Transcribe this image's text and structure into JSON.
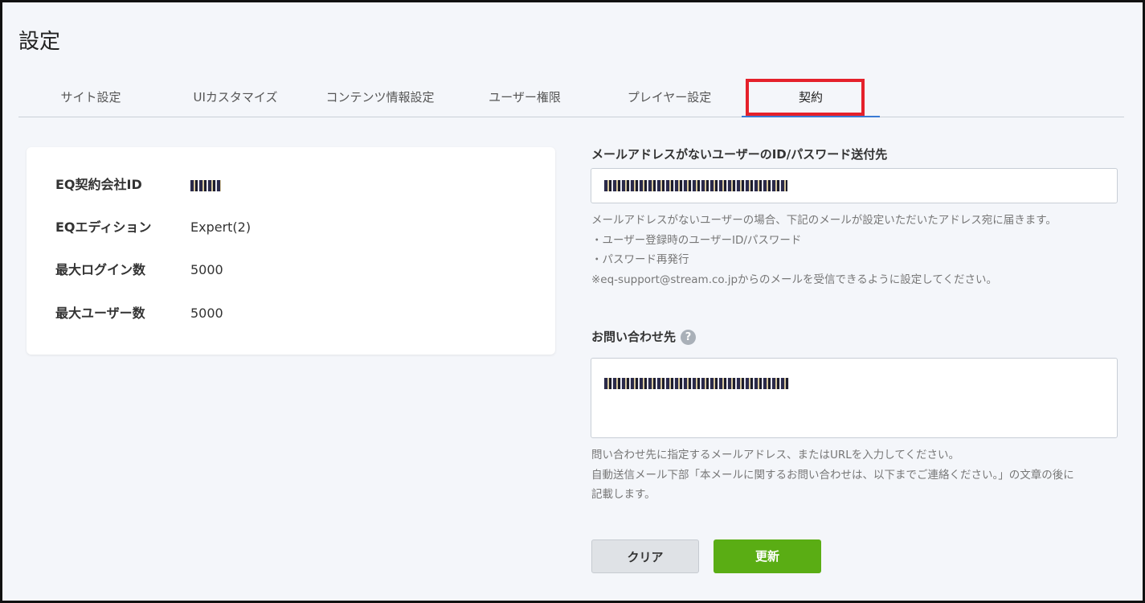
{
  "page": {
    "title": "設定"
  },
  "tabs": [
    {
      "label": "サイト設定"
    },
    {
      "label": "UIカスタマイズ"
    },
    {
      "label": "コンテンツ情報設定"
    },
    {
      "label": "ユーザー権限"
    },
    {
      "label": "プレイヤー設定"
    },
    {
      "label": "契約",
      "active": true
    }
  ],
  "contract": {
    "rows": [
      {
        "label": "EQ契約会社ID",
        "value": "",
        "masked": true
      },
      {
        "label": "EQエディション",
        "value": "Expert(2)"
      },
      {
        "label": "最大ログイン数",
        "value": "5000"
      },
      {
        "label": "最大ユーザー数",
        "value": "5000"
      }
    ]
  },
  "email_section": {
    "label": "メールアドレスがないユーザーのID/パスワード送付先",
    "help": [
      "メールアドレスがないユーザーの場合、下記のメールが設定いただいたアドレス宛に届きます。",
      "・ユーザー登録時のユーザーID/パスワード",
      "・パスワード再発行",
      "※eq-support@stream.co.jpからのメールを受信できるように設定してください。"
    ]
  },
  "contact_section": {
    "label": "お問い合わせ先",
    "help_icon": "?",
    "help": [
      "問い合わせ先に指定するメールアドレス、またはURLを入力してください。",
      "自動送信メール下部「本メールに関するお問い合わせは、以下までご連絡ください。」の文章の後に",
      "記載します。"
    ]
  },
  "buttons": {
    "clear": "クリア",
    "update": "更新"
  },
  "colors": {
    "highlight": "#e5212b",
    "primary": "#5aad14",
    "tab_underline": "#3a7bd5"
  }
}
